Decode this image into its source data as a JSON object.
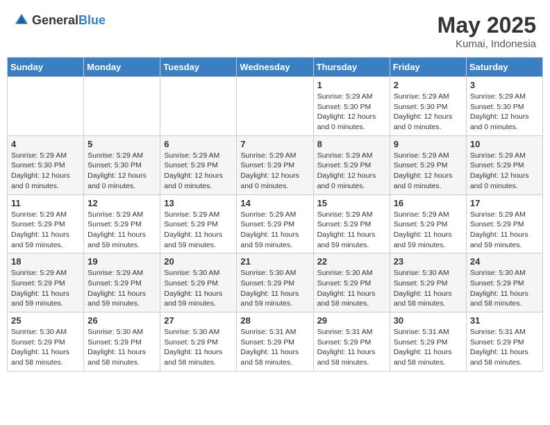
{
  "header": {
    "logo_general": "General",
    "logo_blue": "Blue",
    "title": "May 2025",
    "subtitle": "Kumai, Indonesia"
  },
  "days_of_week": [
    "Sunday",
    "Monday",
    "Tuesday",
    "Wednesday",
    "Thursday",
    "Friday",
    "Saturday"
  ],
  "weeks": [
    [
      {
        "day": "",
        "info": ""
      },
      {
        "day": "",
        "info": ""
      },
      {
        "day": "",
        "info": ""
      },
      {
        "day": "",
        "info": ""
      },
      {
        "day": "1",
        "info": "Sunrise: 5:29 AM\nSunset: 5:30 PM\nDaylight: 12 hours and 0 minutes."
      },
      {
        "day": "2",
        "info": "Sunrise: 5:29 AM\nSunset: 5:30 PM\nDaylight: 12 hours and 0 minutes."
      },
      {
        "day": "3",
        "info": "Sunrise: 5:29 AM\nSunset: 5:30 PM\nDaylight: 12 hours and 0 minutes."
      }
    ],
    [
      {
        "day": "4",
        "info": "Sunrise: 5:29 AM\nSunset: 5:30 PM\nDaylight: 12 hours and 0 minutes."
      },
      {
        "day": "5",
        "info": "Sunrise: 5:29 AM\nSunset: 5:30 PM\nDaylight: 12 hours and 0 minutes."
      },
      {
        "day": "6",
        "info": "Sunrise: 5:29 AM\nSunset: 5:29 PM\nDaylight: 12 hours and 0 minutes."
      },
      {
        "day": "7",
        "info": "Sunrise: 5:29 AM\nSunset: 5:29 PM\nDaylight: 12 hours and 0 minutes."
      },
      {
        "day": "8",
        "info": "Sunrise: 5:29 AM\nSunset: 5:29 PM\nDaylight: 12 hours and 0 minutes."
      },
      {
        "day": "9",
        "info": "Sunrise: 5:29 AM\nSunset: 5:29 PM\nDaylight: 12 hours and 0 minutes."
      },
      {
        "day": "10",
        "info": "Sunrise: 5:29 AM\nSunset: 5:29 PM\nDaylight: 12 hours and 0 minutes."
      }
    ],
    [
      {
        "day": "11",
        "info": "Sunrise: 5:29 AM\nSunset: 5:29 PM\nDaylight: 11 hours and 59 minutes."
      },
      {
        "day": "12",
        "info": "Sunrise: 5:29 AM\nSunset: 5:29 PM\nDaylight: 11 hours and 59 minutes."
      },
      {
        "day": "13",
        "info": "Sunrise: 5:29 AM\nSunset: 5:29 PM\nDaylight: 11 hours and 59 minutes."
      },
      {
        "day": "14",
        "info": "Sunrise: 5:29 AM\nSunset: 5:29 PM\nDaylight: 11 hours and 59 minutes."
      },
      {
        "day": "15",
        "info": "Sunrise: 5:29 AM\nSunset: 5:29 PM\nDaylight: 11 hours and 59 minutes."
      },
      {
        "day": "16",
        "info": "Sunrise: 5:29 AM\nSunset: 5:29 PM\nDaylight: 11 hours and 59 minutes."
      },
      {
        "day": "17",
        "info": "Sunrise: 5:29 AM\nSunset: 5:29 PM\nDaylight: 11 hours and 59 minutes."
      }
    ],
    [
      {
        "day": "18",
        "info": "Sunrise: 5:29 AM\nSunset: 5:29 PM\nDaylight: 11 hours and 59 minutes."
      },
      {
        "day": "19",
        "info": "Sunrise: 5:29 AM\nSunset: 5:29 PM\nDaylight: 11 hours and 59 minutes."
      },
      {
        "day": "20",
        "info": "Sunrise: 5:30 AM\nSunset: 5:29 PM\nDaylight: 11 hours and 59 minutes."
      },
      {
        "day": "21",
        "info": "Sunrise: 5:30 AM\nSunset: 5:29 PM\nDaylight: 11 hours and 59 minutes."
      },
      {
        "day": "22",
        "info": "Sunrise: 5:30 AM\nSunset: 5:29 PM\nDaylight: 11 hours and 58 minutes."
      },
      {
        "day": "23",
        "info": "Sunrise: 5:30 AM\nSunset: 5:29 PM\nDaylight: 11 hours and 58 minutes."
      },
      {
        "day": "24",
        "info": "Sunrise: 5:30 AM\nSunset: 5:29 PM\nDaylight: 11 hours and 58 minutes."
      }
    ],
    [
      {
        "day": "25",
        "info": "Sunrise: 5:30 AM\nSunset: 5:29 PM\nDaylight: 11 hours and 58 minutes."
      },
      {
        "day": "26",
        "info": "Sunrise: 5:30 AM\nSunset: 5:29 PM\nDaylight: 11 hours and 58 minutes."
      },
      {
        "day": "27",
        "info": "Sunrise: 5:30 AM\nSunset: 5:29 PM\nDaylight: 11 hours and 58 minutes."
      },
      {
        "day": "28",
        "info": "Sunrise: 5:31 AM\nSunset: 5:29 PM\nDaylight: 11 hours and 58 minutes."
      },
      {
        "day": "29",
        "info": "Sunrise: 5:31 AM\nSunset: 5:29 PM\nDaylight: 11 hours and 58 minutes."
      },
      {
        "day": "30",
        "info": "Sunrise: 5:31 AM\nSunset: 5:29 PM\nDaylight: 11 hours and 58 minutes."
      },
      {
        "day": "31",
        "info": "Sunrise: 5:31 AM\nSunset: 5:29 PM\nDaylight: 11 hours and 58 minutes."
      }
    ]
  ]
}
